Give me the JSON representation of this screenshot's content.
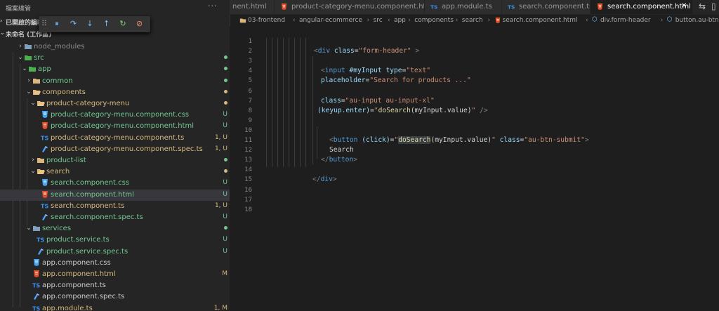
{
  "colors": {
    "folder": "#dcb67a",
    "html": "#e44d26",
    "css": "#42a5f5",
    "ts": "#3b8eea",
    "spec": "#4fa3ff",
    "modified": "#d7ba7d",
    "untracked": "#73c991",
    "default_text": "#cccccc"
  },
  "sidebar": {
    "title": "檔案總管",
    "more": "···",
    "sections": [
      {
        "label": "已開啟的編輯器"
      },
      {
        "label": "未命名 (工作區)"
      }
    ],
    "tree": [
      {
        "label": "node_modules",
        "kind": "folder-special",
        "indent": 1,
        "twisty": "›",
        "color": "#8c8c8c",
        "status": "",
        "dot": false
      },
      {
        "label": "src",
        "kind": "folder-src",
        "indent": 1,
        "twisty": "⌄",
        "color": "#73c991",
        "status": "",
        "dot": true
      },
      {
        "label": "app",
        "kind": "folder-app",
        "indent": 2,
        "twisty": "⌄",
        "color": "#73c991",
        "status": "",
        "dot": true
      },
      {
        "label": "common",
        "kind": "folder",
        "indent": 3,
        "twisty": "›",
        "color": "#73c991",
        "status": "",
        "dot": true
      },
      {
        "label": "components",
        "kind": "folder-open",
        "indent": 3,
        "twisty": "⌄",
        "color": "#d7ba7d",
        "status": "",
        "dot": true
      },
      {
        "label": "product-category-menu",
        "kind": "folder-open",
        "indent": 4,
        "twisty": "⌄",
        "color": "#d7ba7d",
        "status": "",
        "dot": true
      },
      {
        "label": "product-category-menu.component.css",
        "kind": "css",
        "indent": 5,
        "twisty": "",
        "color": "#73c991",
        "status": "U",
        "dot": false
      },
      {
        "label": "product-category-menu.component.html",
        "kind": "html",
        "indent": 5,
        "twisty": "",
        "color": "#73c991",
        "status": "U",
        "dot": false
      },
      {
        "label": "product-category-menu.component.ts",
        "kind": "ts",
        "indent": 5,
        "twisty": "",
        "color": "#d7ba7d",
        "status": "1, U",
        "dot": false
      },
      {
        "label": "product-category-menu.component.spec.ts",
        "kind": "spec",
        "indent": 5,
        "twisty": "",
        "color": "#d7ba7d",
        "status": "1, U",
        "dot": false
      },
      {
        "label": "product-list",
        "kind": "folder",
        "indent": 4,
        "twisty": "›",
        "color": "#73c991",
        "status": "",
        "dot": true
      },
      {
        "label": "search",
        "kind": "folder-open",
        "indent": 4,
        "twisty": "⌄",
        "color": "#d7ba7d",
        "status": "",
        "dot": true
      },
      {
        "label": "search.component.css",
        "kind": "css",
        "indent": 5,
        "twisty": "",
        "color": "#73c991",
        "status": "U",
        "dot": false
      },
      {
        "label": "search.component.html",
        "kind": "html",
        "indent": 5,
        "twisty": "",
        "color": "#73c991",
        "status": "U",
        "dot": false,
        "selected": true
      },
      {
        "label": "search.component.ts",
        "kind": "ts",
        "indent": 5,
        "twisty": "",
        "color": "#d7ba7d",
        "status": "1, U",
        "dot": false
      },
      {
        "label": "search.component.spec.ts",
        "kind": "spec",
        "indent": 5,
        "twisty": "",
        "color": "#73c991",
        "status": "U",
        "dot": false
      },
      {
        "label": "services",
        "kind": "folder-special",
        "indent": 3,
        "twisty": "⌄",
        "color": "#73c991",
        "status": "",
        "dot": true
      },
      {
        "label": "product.service.ts",
        "kind": "ts",
        "indent": 4,
        "twisty": "",
        "color": "#73c991",
        "status": "U",
        "dot": false
      },
      {
        "label": "product.service.spec.ts",
        "kind": "spec",
        "indent": 4,
        "twisty": "",
        "color": "#73c991",
        "status": "U",
        "dot": false
      },
      {
        "label": "app.component.css",
        "kind": "css",
        "indent": 3,
        "twisty": "",
        "color": "#cccccc",
        "status": "",
        "dot": false
      },
      {
        "label": "app.component.html",
        "kind": "html",
        "indent": 3,
        "twisty": "",
        "color": "#d7ba7d",
        "status": "M",
        "dot": false
      },
      {
        "label": "app.component.ts",
        "kind": "ts",
        "indent": 3,
        "twisty": "",
        "color": "#cccccc",
        "status": "",
        "dot": false
      },
      {
        "label": "app.component.spec.ts",
        "kind": "spec",
        "indent": 3,
        "twisty": "",
        "color": "#cccccc",
        "status": "",
        "dot": false
      },
      {
        "label": "app.module.ts",
        "kind": "ts",
        "indent": 3,
        "twisty": "",
        "color": "#d7ba7d",
        "status": "1, M",
        "dot": false
      }
    ]
  },
  "debug_toolbar": {
    "buttons": [
      {
        "name": "pause-icon",
        "glyph": "⏸",
        "color": "#75beff"
      },
      {
        "name": "step-over-icon",
        "glyph": "↷",
        "color": "#75beff"
      },
      {
        "name": "step-into-icon",
        "glyph": "↓",
        "color": "#75beff"
      },
      {
        "name": "step-out-icon",
        "glyph": "↑",
        "color": "#75beff"
      },
      {
        "name": "restart-icon",
        "glyph": "↻",
        "color": "#89d185"
      },
      {
        "name": "disconnect-icon",
        "glyph": "⊘",
        "color": "#f48771"
      }
    ]
  },
  "tabs": [
    {
      "label": "nent.html",
      "kind": "none",
      "active": false
    },
    {
      "label": "product-category-menu.component.html",
      "kind": "html",
      "active": false
    },
    {
      "label": "app.module.ts",
      "kind": "ts",
      "active": false
    },
    {
      "label": "search.component.ts",
      "kind": "ts",
      "active": false
    },
    {
      "label": "search.component.html",
      "kind": "html",
      "active": true,
      "close": "✕"
    }
  ],
  "tab_actions": [
    "split-compare-icon",
    "split-editor-icon"
  ],
  "breadcrumb": [
    {
      "label": "03-frontend",
      "kind": "folder"
    },
    {
      "label": "angular-ecommerce",
      "kind": "text"
    },
    {
      "label": "src",
      "kind": "text"
    },
    {
      "label": "app",
      "kind": "text"
    },
    {
      "label": "components",
      "kind": "text"
    },
    {
      "label": "search",
      "kind": "text"
    },
    {
      "label": "search.component.html",
      "kind": "html"
    },
    {
      "label": "div.form-header",
      "kind": "element"
    },
    {
      "label": "button.au-btn-submit",
      "kind": "element"
    }
  ],
  "editor": {
    "line_numbers": [
      "1",
      "2",
      "3",
      "4",
      "5",
      "6",
      "7",
      "8",
      "9",
      "10",
      "11",
      "12",
      "13",
      "14",
      "15",
      "16",
      "17",
      "18"
    ],
    "lines": [
      [],
      [
        {
          "t": "<",
          "c": "punc"
        },
        {
          "t": "div",
          "c": "tag"
        },
        {
          "t": " "
        },
        {
          "t": "class",
          "c": "attr"
        },
        {
          "t": "=",
          "c": "txt"
        },
        {
          "t": "\"form-header\"",
          "c": "str"
        },
        {
          "t": " >",
          "c": "punc"
        }
      ],
      [],
      [
        {
          "t": "<",
          "c": "punc"
        },
        {
          "t": "input",
          "c": "tag"
        },
        {
          "t": " "
        },
        {
          "t": "#myInput",
          "c": "attr"
        },
        {
          "t": " "
        },
        {
          "t": "type",
          "c": "attr"
        },
        {
          "t": "=",
          "c": "txt"
        },
        {
          "t": "\"text\"",
          "c": "str"
        }
      ],
      [
        {
          "t": "placeholder",
          "c": "attr"
        },
        {
          "t": "=",
          "c": "txt"
        },
        {
          "t": "\"Search for products ...\"",
          "c": "str"
        }
      ],
      [],
      [
        {
          "t": "class",
          "c": "attr"
        },
        {
          "t": "=",
          "c": "txt"
        },
        {
          "t": "\"au-input au-input-xl\"",
          "c": "str"
        }
      ],
      [
        {
          "t": "(keyup.enter)",
          "c": "attr"
        },
        {
          "t": "=",
          "c": "txt"
        },
        {
          "t": "\"",
          "c": "str"
        },
        {
          "t": "doSearch",
          "c": "fn"
        },
        {
          "t": "(myInput.value)",
          "c": "txt"
        },
        {
          "t": "\"",
          "c": "str"
        },
        {
          "t": " />",
          "c": "punc"
        }
      ],
      [],
      [],
      [
        {
          "t": "<",
          "c": "punc"
        },
        {
          "t": "button",
          "c": "tag"
        },
        {
          "t": " "
        },
        {
          "t": "(click)",
          "c": "attr"
        },
        {
          "t": "=",
          "c": "txt"
        },
        {
          "t": "\"",
          "c": "str"
        },
        {
          "t": "doSearch",
          "c": "fn",
          "hl": true
        },
        {
          "t": "(myInput.value)",
          "c": "txt"
        },
        {
          "t": "\"",
          "c": "str"
        },
        {
          "t": " "
        },
        {
          "t": "class",
          "c": "attr"
        },
        {
          "t": "=",
          "c": "txt"
        },
        {
          "t": "\"au-btn-submit\"",
          "c": "str"
        },
        {
          "t": ">",
          "c": "punc"
        }
      ],
      [
        {
          "t": "Search",
          "c": "txt"
        }
      ],
      [
        {
          "t": "</",
          "c": "punc"
        },
        {
          "t": "button",
          "c": "tag"
        },
        {
          "t": ">",
          "c": "punc"
        }
      ],
      [],
      [
        {
          "t": "</",
          "c": "punc"
        },
        {
          "t": "div",
          "c": "tag"
        },
        {
          "t": ">",
          "c": "punc"
        }
      ],
      [],
      [],
      []
    ],
    "line_indent": [
      0,
      1,
      0,
      2,
      2,
      0,
      2,
      1.5,
      0,
      0,
      3,
      4,
      3,
      0,
      1,
      0,
      0,
      0
    ]
  }
}
